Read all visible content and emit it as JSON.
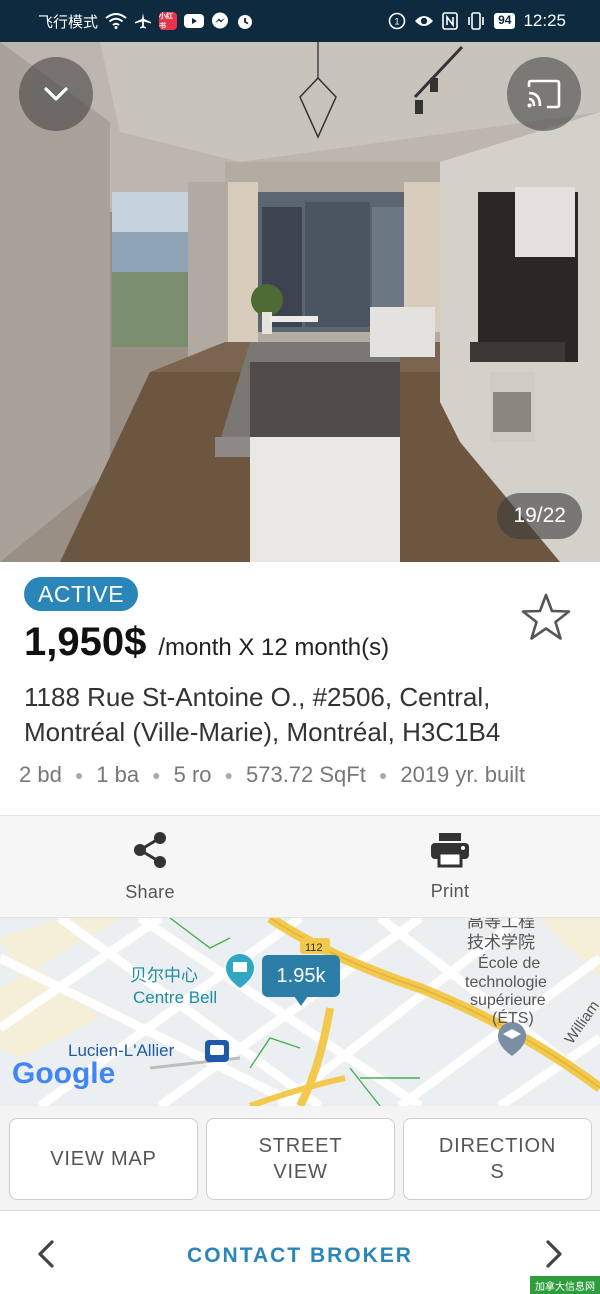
{
  "status_bar": {
    "mode_text": "飞行模式",
    "time": "12:25",
    "battery": "94",
    "app_badge": "小红书"
  },
  "gallery": {
    "counter": "19/22",
    "collapse_icon": "chevron-down-icon",
    "cast_icon": "cast-icon"
  },
  "listing": {
    "status": "ACTIVE",
    "price": "1,950$",
    "price_suffix": "/month X 12 month(s)",
    "address_line1": "1188 Rue St-Antoine O., #2506, Central,",
    "address_line2": "Montréal (Ville-Marie), Montréal, H3C1B4",
    "facts": [
      "2 bd",
      "1 ba",
      "5 ro",
      "573.72 SqFt",
      "2019 yr. built"
    ]
  },
  "actions": {
    "share_label": "Share",
    "print_label": "Print"
  },
  "map": {
    "price_bubble": "1.95k",
    "labels": {
      "bell_cn": "贝尔中心",
      "bell": "Centre Bell",
      "lucien": "Lucien-L'Allier",
      "ets_cn_1": "高等工程",
      "ets_cn_2": "技术学院",
      "ets_1": "École de",
      "ets_2": "technologie",
      "ets_3": "supérieure",
      "ets_4": "(ÉTS)",
      "william": "William",
      "route": "112",
      "google": "Google"
    }
  },
  "buttons": {
    "view_map": "VIEW MAP",
    "street_view_1": "STREET",
    "street_view_2": "VIEW",
    "directions_1": "DIRECTION",
    "directions_2": "S"
  },
  "bottom_nav": {
    "contact": "CONTACT BROKER"
  },
  "watermark": "加拿大信息网"
}
